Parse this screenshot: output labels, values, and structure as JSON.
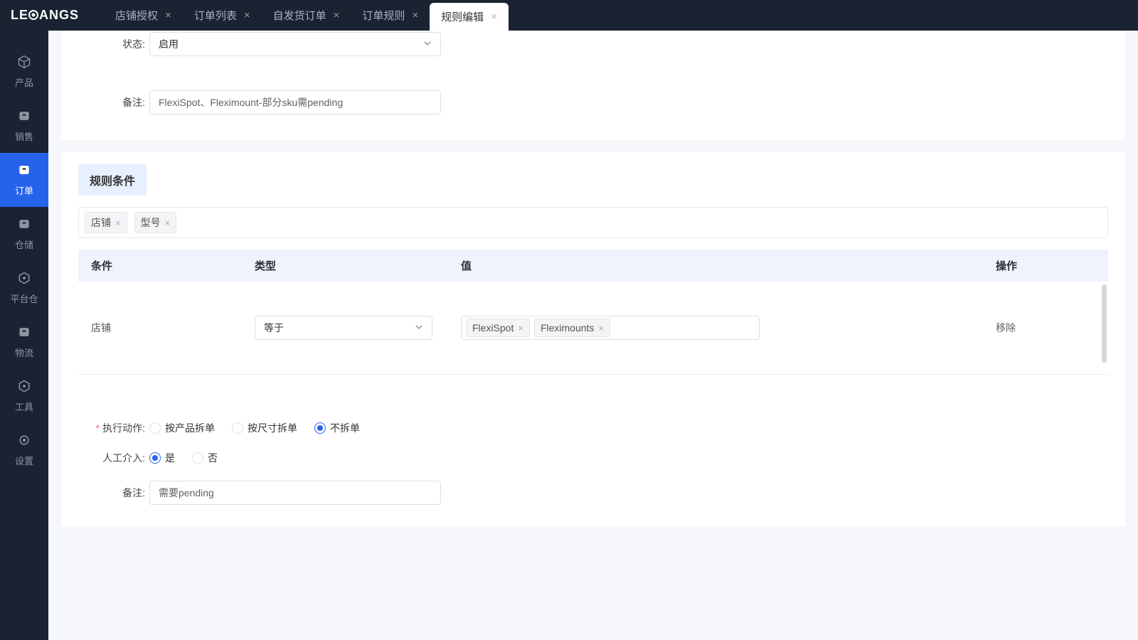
{
  "logo_prefix": "LE",
  "logo_suffix": "ANGS",
  "tabs": [
    {
      "label": "店铺授权",
      "active": false
    },
    {
      "label": "订单列表",
      "active": false
    },
    {
      "label": "自发货订单",
      "active": false
    },
    {
      "label": "订单规则",
      "active": false
    },
    {
      "label": "规则编辑",
      "active": true
    }
  ],
  "sidebar": [
    {
      "label": "产品",
      "icon": "cube",
      "active": false
    },
    {
      "label": "销售",
      "icon": "box",
      "active": false
    },
    {
      "label": "订单",
      "icon": "box",
      "active": true
    },
    {
      "label": "仓储",
      "icon": "box",
      "active": false
    },
    {
      "label": "平台仓",
      "icon": "hex",
      "active": false
    },
    {
      "label": "物流",
      "icon": "box",
      "active": false
    },
    {
      "label": "工具",
      "icon": "hex",
      "active": false
    },
    {
      "label": "设置",
      "icon": "gear",
      "active": false
    }
  ],
  "top_form": {
    "status_label": "状态:",
    "status_value": "启用",
    "remark_label": "备注:",
    "remark_value": "FlexiSpot、Fleximount-部分sku需pending"
  },
  "rule_section": {
    "title": "规则条件",
    "filter_tags": [
      "店铺",
      "型号"
    ],
    "columns": {
      "cond": "条件",
      "type": "类型",
      "value": "值",
      "action": "操作"
    },
    "rows": [
      {
        "cond": "店铺",
        "type": "等于",
        "values": [
          "FlexiSpot",
          "Fleximounts"
        ],
        "action": "移除"
      }
    ]
  },
  "bottom_form": {
    "action_label": "执行动作:",
    "action_options": [
      "按产品拆单",
      "按尺寸拆单",
      "不拆单"
    ],
    "action_selected": 2,
    "manual_label": "人工介入:",
    "manual_options": [
      "是",
      "否"
    ],
    "manual_selected": 0,
    "remark_label": "备注:",
    "remark_value": "需要pending"
  }
}
